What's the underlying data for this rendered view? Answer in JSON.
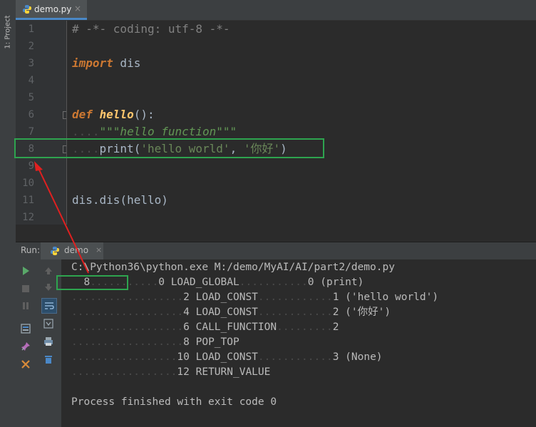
{
  "sidebar": {
    "project_label": "1: Project"
  },
  "tab": {
    "label": "demo.py",
    "close": "×"
  },
  "editor": {
    "line_numbers": [
      "1",
      "2",
      "3",
      "4",
      "5",
      "6",
      "7",
      "8",
      "9",
      "10",
      "11",
      "12"
    ],
    "lines": {
      "l1": "# -*- coding: utf-8 -*-",
      "l3_kw": "import",
      "l3_rest": " dis",
      "l6_kw": "def",
      "l6_sp": " ",
      "l6_fn": "hello",
      "l6_rest": "():",
      "l7_dots": "....",
      "l7_doc": "\"\"\"hello function\"\"\"",
      "l8_dots": "....",
      "l8_pre": "print(",
      "l8_s1": "'hello world'",
      "l8_mid": ", ",
      "l8_s2": "'你好'",
      "l8_post": ")",
      "l11": "dis.dis(hello)"
    }
  },
  "run": {
    "label": "Run:",
    "tab_label": "demo",
    "tab_close": "×"
  },
  "console": {
    "command": "C:\\Python36\\python.exe M:/demo/MyAI/AI/part2/demo.py",
    "lines": [
      {
        "lead": "  ",
        "lineno": "8",
        "d1": "...........",
        "off": "0",
        "op": "LOAD_GLOBAL",
        "d2": "...........",
        "arg": "0",
        "repr": "(print)"
      },
      {
        "lead": "",
        "lineno": "",
        "d1": "..................",
        "off": "2",
        "op": "LOAD_CONST",
        "d2": "............",
        "arg": "1",
        "repr": "('hello world')"
      },
      {
        "lead": "",
        "lineno": "",
        "d1": "..................",
        "off": "4",
        "op": "LOAD_CONST",
        "d2": "............",
        "arg": "2",
        "repr": "('你好')"
      },
      {
        "lead": "",
        "lineno": "",
        "d1": "..................",
        "off": "6",
        "op": "CALL_FUNCTION",
        "d2": ".........",
        "arg": "2",
        "repr": ""
      },
      {
        "lead": "",
        "lineno": "",
        "d1": "..................",
        "off": "8",
        "op": "POP_TOP",
        "d2": "",
        "arg": "",
        "repr": ""
      },
      {
        "lead": "",
        "lineno": "",
        "d1": ".................",
        "off": "10",
        "op": "LOAD_CONST",
        "d2": "............",
        "arg": "3",
        "repr": "(None)"
      },
      {
        "lead": "",
        "lineno": "",
        "d1": ".................",
        "off": "12",
        "op": "RETURN_VALUE",
        "d2": "",
        "arg": "",
        "repr": ""
      }
    ],
    "exit_message": "Process finished with exit code 0"
  },
  "colors": {
    "highlight_box": "#2ea44f",
    "arrow": "#e02020",
    "run_green": "#59a869",
    "stop_gray": "#6e6e6e"
  }
}
